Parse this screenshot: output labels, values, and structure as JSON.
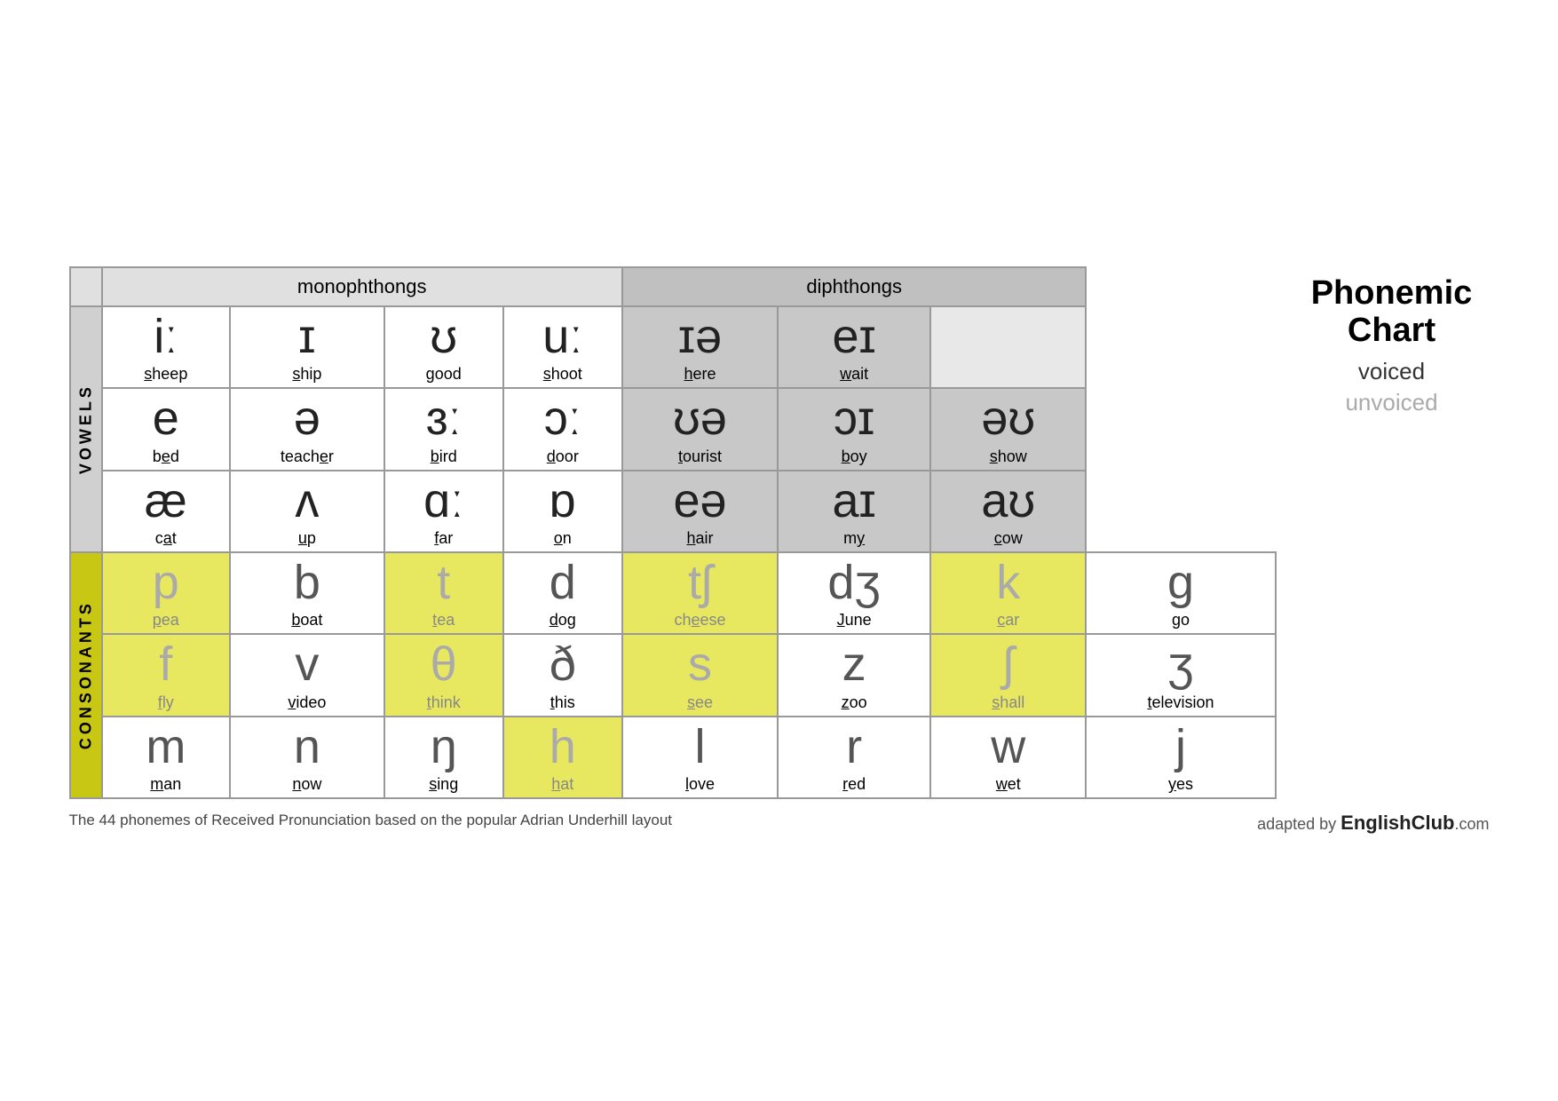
{
  "title": "Phonemic Chart",
  "legend": {
    "voiced": "voiced",
    "unvoiced": "unvoiced"
  },
  "headers": {
    "monophthongs": "monophthongs",
    "diphthongs": "diphthongs"
  },
  "sections": {
    "vowels": "VOWELS",
    "consonants": "CONSONANTS"
  },
  "vowelRows": [
    {
      "cells": [
        {
          "symbol": "iː",
          "word": "sheep",
          "underline": 0,
          "type": "mono"
        },
        {
          "symbol": "ɪ",
          "word": "ship",
          "underline": 0,
          "type": "mono"
        },
        {
          "symbol": "ʊ",
          "word": "good",
          "underline": 0,
          "type": "mono"
        },
        {
          "symbol": "uː",
          "word": "shoot",
          "underline": 0,
          "type": "mono"
        },
        {
          "symbol": "ɪə",
          "word": "here",
          "underline": 0,
          "type": "diph"
        },
        {
          "symbol": "eɪ",
          "word": "wait",
          "underline": 0,
          "type": "diph"
        },
        {
          "symbol": "",
          "word": "",
          "underline": -1,
          "type": "empty"
        }
      ]
    },
    {
      "cells": [
        {
          "symbol": "e",
          "word": "bed",
          "underline": 1,
          "type": "mono"
        },
        {
          "symbol": "ə",
          "word": "teacher",
          "underline": 5,
          "type": "mono"
        },
        {
          "symbol": "ɜː",
          "word": "bird",
          "underline": 0,
          "type": "mono"
        },
        {
          "symbol": "ɔː",
          "word": "door",
          "underline": 0,
          "type": "mono"
        },
        {
          "symbol": "ʊə",
          "word": "tourist",
          "underline": 0,
          "type": "diph"
        },
        {
          "symbol": "ɔɪ",
          "word": "boy",
          "underline": 0,
          "type": "diph"
        },
        {
          "symbol": "əʊ",
          "word": "show",
          "underline": 0,
          "type": "diph"
        }
      ]
    },
    {
      "cells": [
        {
          "symbol": "æ",
          "word": "cat",
          "underline": 1,
          "type": "mono"
        },
        {
          "symbol": "ʌ",
          "word": "up",
          "underline": 0,
          "type": "mono"
        },
        {
          "symbol": "ɑː",
          "word": "far",
          "underline": 0,
          "type": "mono"
        },
        {
          "symbol": "ɒ",
          "word": "on",
          "underline": 0,
          "type": "mono"
        },
        {
          "symbol": "eə",
          "word": "hair",
          "underline": 0,
          "type": "diph"
        },
        {
          "symbol": "aɪ",
          "word": "my",
          "underline": 1,
          "type": "diph"
        },
        {
          "symbol": "aʊ",
          "word": "cow",
          "underline": 0,
          "type": "diph"
        }
      ]
    }
  ],
  "consonantRows": [
    {
      "cells": [
        {
          "symbol": "p",
          "word": "pea",
          "underline": 0,
          "voiced": false
        },
        {
          "symbol": "b",
          "word": "boat",
          "underline": 0,
          "voiced": true
        },
        {
          "symbol": "t",
          "word": "tea",
          "underline": 0,
          "voiced": false
        },
        {
          "symbol": "d",
          "word": "dog",
          "underline": 0,
          "voiced": true
        },
        {
          "symbol": "tʃ",
          "word": "cheese",
          "underline": 2,
          "voiced": false
        },
        {
          "symbol": "dʒ",
          "word": "June",
          "underline": 0,
          "voiced": true
        },
        {
          "symbol": "k",
          "word": "car",
          "underline": 0,
          "voiced": false
        },
        {
          "symbol": "g",
          "word": "go",
          "underline": 0,
          "voiced": true
        }
      ]
    },
    {
      "cells": [
        {
          "symbol": "f",
          "word": "fly",
          "underline": 0,
          "voiced": false
        },
        {
          "symbol": "v",
          "word": "video",
          "underline": 0,
          "voiced": true
        },
        {
          "symbol": "θ",
          "word": "think",
          "underline": 0,
          "voiced": false
        },
        {
          "symbol": "ð",
          "word": "this",
          "underline": 0,
          "voiced": true
        },
        {
          "symbol": "s",
          "word": "see",
          "underline": 0,
          "voiced": false
        },
        {
          "symbol": "z",
          "word": "zoo",
          "underline": 0,
          "voiced": true
        },
        {
          "symbol": "ʃ",
          "word": "shall",
          "underline": 0,
          "voiced": false
        },
        {
          "symbol": "ʒ",
          "word": "television",
          "underline": 0,
          "voiced": true
        }
      ]
    },
    {
      "cells": [
        {
          "symbol": "m",
          "word": "man",
          "underline": 0,
          "voiced": true
        },
        {
          "symbol": "n",
          "word": "now",
          "underline": 0,
          "voiced": true
        },
        {
          "symbol": "ŋ",
          "word": "sing",
          "underline": 0,
          "voiced": true
        },
        {
          "symbol": "h",
          "word": "hat",
          "underline": 0,
          "voiced": false
        },
        {
          "symbol": "l",
          "word": "love",
          "underline": 0,
          "voiced": true
        },
        {
          "symbol": "r",
          "word": "red",
          "underline": 0,
          "voiced": true
        },
        {
          "symbol": "w",
          "word": "wet",
          "underline": 0,
          "voiced": true
        },
        {
          "symbol": "j",
          "word": "yes",
          "underline": 0,
          "voiced": true
        }
      ]
    }
  ],
  "footnote": {
    "left": "The 44 phonemes of Received Pronunciation based on the popular Adrian Underhill layout",
    "right_prefix": "adapted by ",
    "right_brand": "EnglishClub",
    "right_suffix": ".com"
  }
}
